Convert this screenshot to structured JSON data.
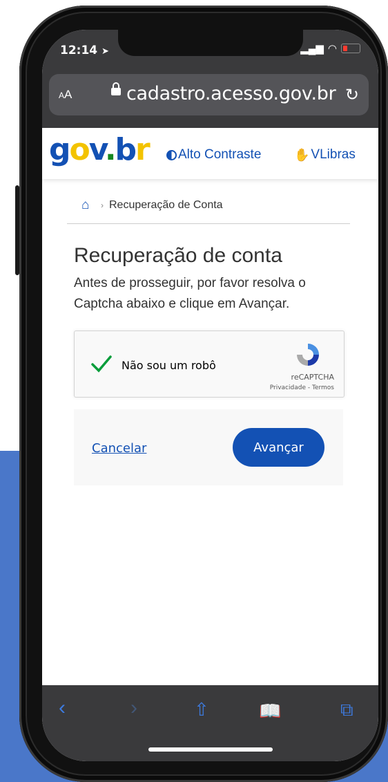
{
  "status_bar": {
    "time": "12:14",
    "signal_icon": "signal-icon",
    "wifi_icon": "wifi-icon",
    "battery_icon": "battery-icon"
  },
  "browser": {
    "text_size_label": "AA",
    "url": "cadastro.acesso.gov.br"
  },
  "header": {
    "logo_text": "gov.br",
    "high_contrast": "Alto Contraste",
    "vlibras": "VLibras"
  },
  "breadcrumb": {
    "current": "Recuperação de Conta"
  },
  "page": {
    "title": "Recuperação de conta",
    "description": "Antes de prosseguir, por favor resolva o Captcha abaixo e clique em Avançar."
  },
  "recaptcha": {
    "label": "Não sou um robô",
    "brand": "reCAPTCHA",
    "privacy": "Privacidade",
    "terms": "Termos",
    "checked": true
  },
  "actions": {
    "cancel": "Cancelar",
    "advance": "Avançar"
  },
  "colors": {
    "primary": "#1351b4",
    "brand_yellow": "#f3c300",
    "brand_green": "#168821"
  }
}
